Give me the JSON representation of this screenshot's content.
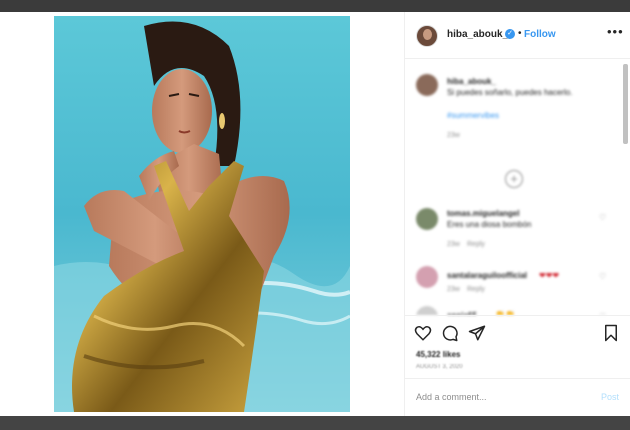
{
  "post": {
    "username": "hiba_abouk_",
    "verified_glyph": "✓",
    "separator": "•",
    "follow_label": "Follow",
    "more_label": "•••"
  },
  "caption": {
    "username": "hiba_abouk_",
    "text": "Si puedes soñarlo, puedes hacerlo.",
    "hashtag": "#summervibes",
    "time": "23w"
  },
  "comments": [
    {
      "username": "tomas.miguelangel",
      "text": "Eres una diosa bombón",
      "time": "23w",
      "reply": "Reply"
    },
    {
      "username": "santalaraguiloofficial",
      "text": "❤❤❤",
      "time": "23w",
      "reply": "Reply"
    },
    {
      "username": "annie65",
      "text": "👏👏",
      "time": "",
      "reply": ""
    }
  ],
  "load_more_label": "+",
  "stats": {
    "likes": "45,322 likes",
    "date": "AUGUST 3, 2020"
  },
  "comment_input": {
    "placeholder": "Add a comment...",
    "post_label": "Post"
  },
  "colors": {
    "accent": "#3897f0",
    "pool_blue": "#4fc3d6",
    "suit_gold": "#b8922c"
  },
  "icons": [
    "heart-icon",
    "comment-icon",
    "share-icon",
    "bookmark-icon",
    "verified-icon",
    "more-icon"
  ]
}
